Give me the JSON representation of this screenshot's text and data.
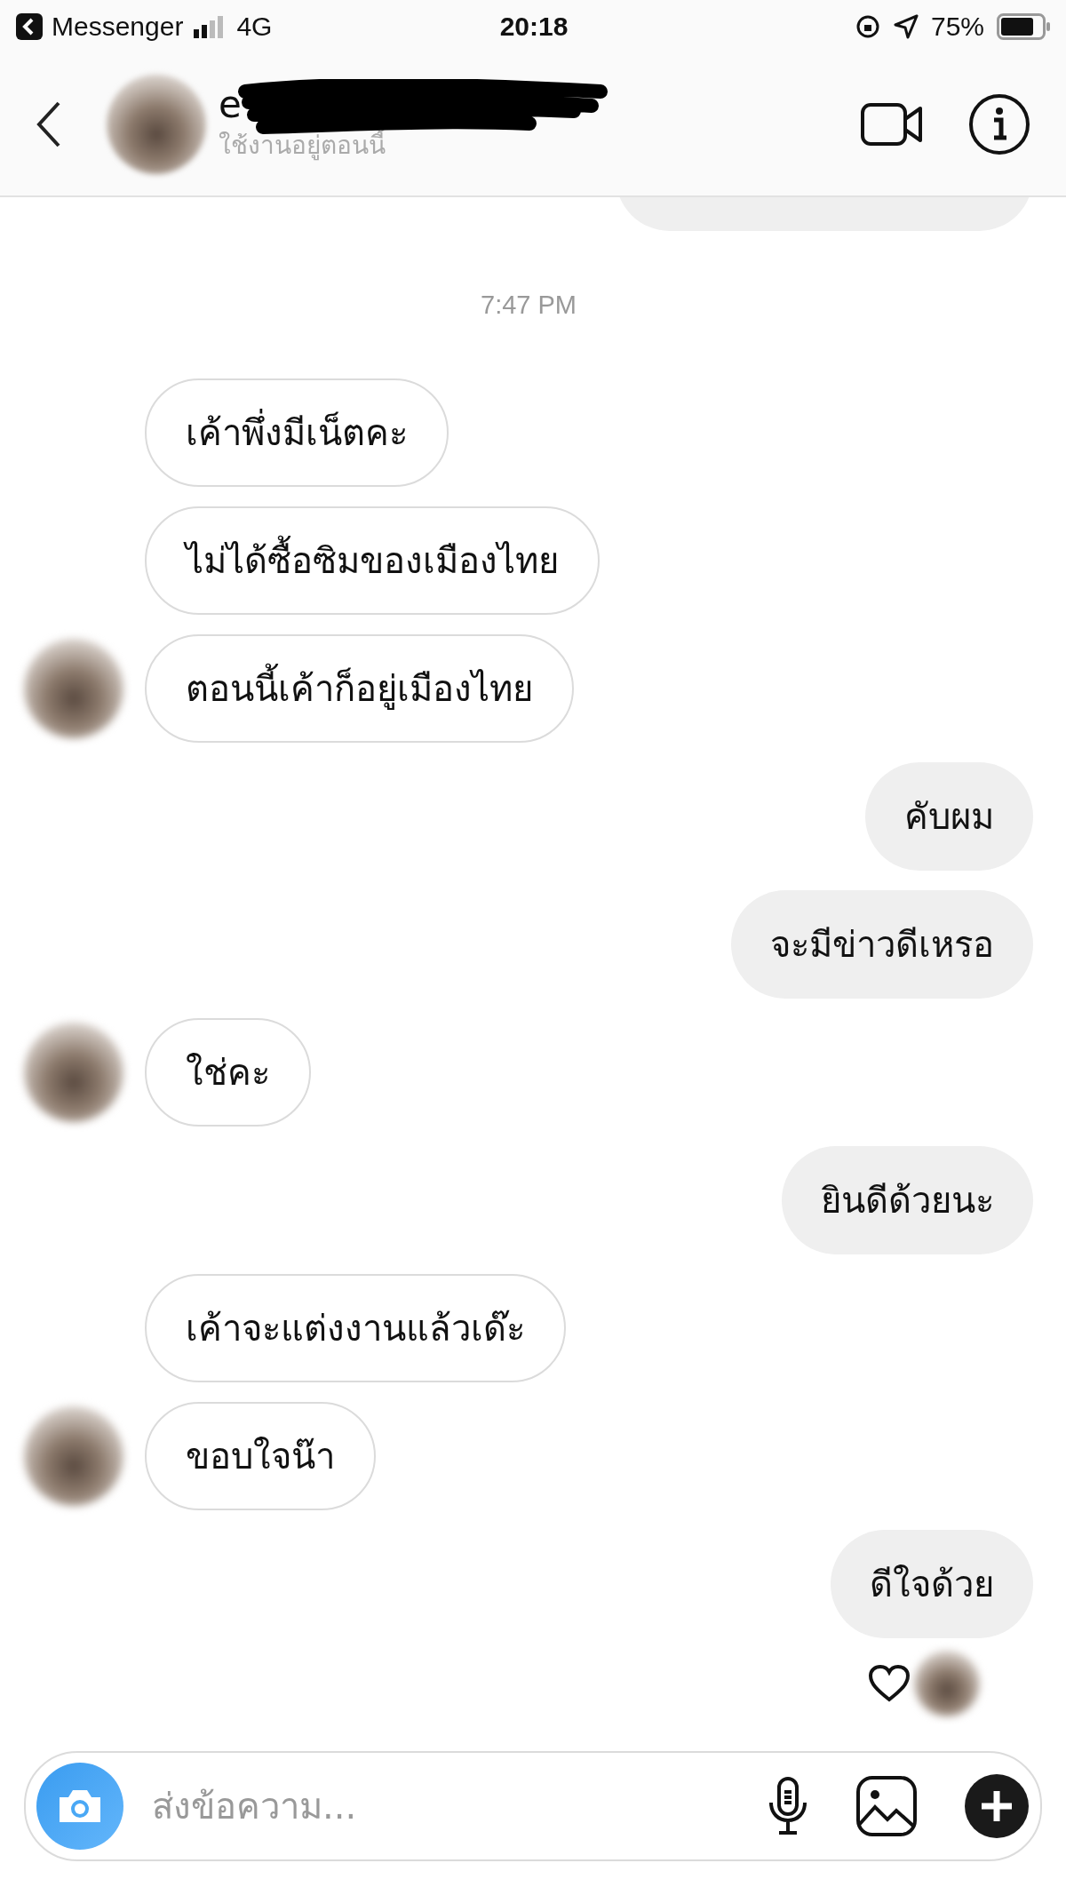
{
  "status_bar": {
    "back_app": "Messenger",
    "network": "4G",
    "time": "20:18",
    "battery": "75%"
  },
  "header": {
    "name": "e",
    "status": "ใช้งานอยู่ตอนนี้"
  },
  "messages": [
    {
      "kind": "partial"
    },
    {
      "kind": "time",
      "text": "7:47 PM"
    },
    {
      "kind": "incoming",
      "text": "เค้าพึ่งมีเน็ตคะ",
      "avatar": false
    },
    {
      "kind": "incoming",
      "text": "ไม่ได้ซื้อซิมของเมืองไทย",
      "avatar": false
    },
    {
      "kind": "incoming",
      "text": "ตอนนี้เค้าก็อยู่เมืองไทย",
      "avatar": true
    },
    {
      "kind": "outgoing",
      "text": "คับผม"
    },
    {
      "kind": "outgoing",
      "text": "จะมีข่าวดีเหรอ"
    },
    {
      "kind": "incoming",
      "text": "ใช่คะ",
      "avatar": true
    },
    {
      "kind": "outgoing",
      "text": "ยินดีด้วยนะ"
    },
    {
      "kind": "incoming",
      "text": "เค้าจะแต่งงานแล้วเด๊ะ",
      "avatar": false
    },
    {
      "kind": "incoming",
      "text": "ขอบใจน๊า",
      "avatar": true
    },
    {
      "kind": "outgoing",
      "text": "ดีใจด้วย"
    }
  ],
  "reaction": {
    "liked": true
  },
  "composer": {
    "placeholder": "ส่งข้อความ..."
  }
}
